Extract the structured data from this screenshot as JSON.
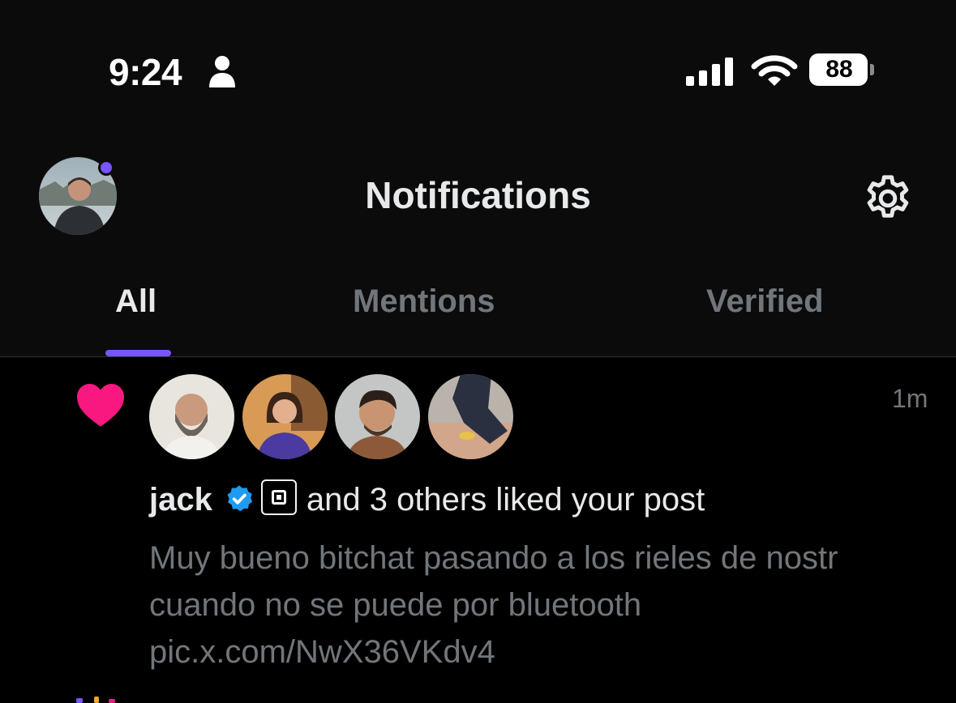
{
  "status_bar": {
    "time": "9:24",
    "battery": "88",
    "battery_level": 0.88
  },
  "header": {
    "title": "Notifications"
  },
  "tabs": [
    {
      "label": "All",
      "active": true
    },
    {
      "label": "Mentions",
      "active": false
    },
    {
      "label": "Verified",
      "active": false
    }
  ],
  "notification": {
    "icon": "heart-icon",
    "time_ago": "1m",
    "user_name": "jack",
    "summary": "and 3 others liked your post",
    "post_text": "Muy bueno bitchat pasando a los rieles de nostr cuando no se puede por bluetooth pic.x.com/NwX36VKdv4"
  },
  "colors": {
    "accent": "#7856ff",
    "heart": "#f91880",
    "verified": "#1d9bf0",
    "text_primary": "#e7e9ea",
    "text_secondary": "#71767b",
    "background": "#000000"
  }
}
